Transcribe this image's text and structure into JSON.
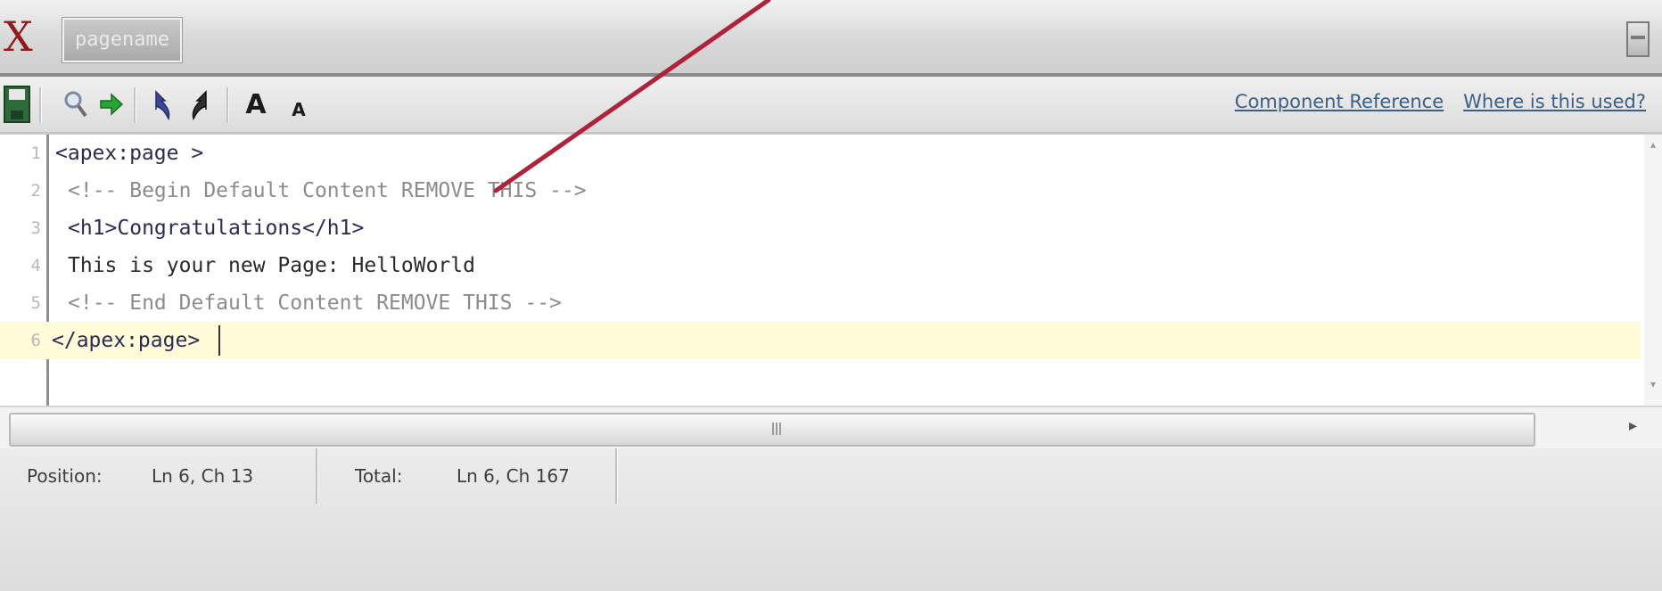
{
  "titlebar": {
    "close_label": "X",
    "name_box_text": "pagename"
  },
  "toolbar": {
    "font_larger_label": "A",
    "font_smaller_label": "A",
    "links": {
      "component_reference": "Component Reference",
      "where_used": "Where is this used?"
    },
    "icons": [
      "save-icon",
      "find-icon",
      "go-to-line-icon",
      "undo-icon",
      "redo-icon",
      "font-larger-icon",
      "font-smaller-icon"
    ]
  },
  "editor": {
    "lines": [
      {
        "num": "1",
        "text": "<apex:page >"
      },
      {
        "num": "2",
        "text": "<!-- Begin Default Content REMOVE THIS -->"
      },
      {
        "num": "3",
        "text": "<h1>Congratulations</h1>"
      },
      {
        "num": "4",
        "text": "This is your new Page: HelloWorld"
      },
      {
        "num": "5",
        "text": "<!-- End Default Content REMOVE THIS -->"
      },
      {
        "num": "6",
        "text": "</apex:page>"
      }
    ],
    "current_line": 6
  },
  "statusbar": {
    "position_label": "Position:",
    "position_value": "Ln 6, Ch 13",
    "total_label": "Total:",
    "total_value": "Ln 6, Ch 167"
  },
  "colors": {
    "annotation_arrow": "#b0213a",
    "current_line_bg": "#fffbd8",
    "link": "#3b5f86"
  }
}
